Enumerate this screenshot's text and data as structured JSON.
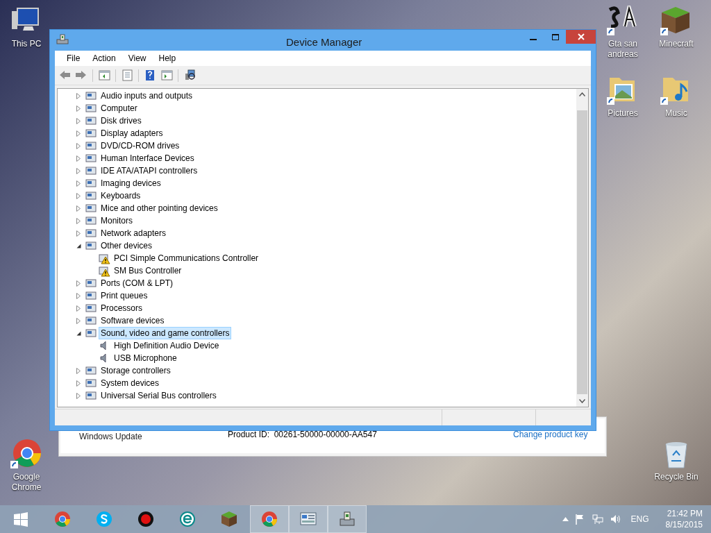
{
  "desktop_icons": [
    {
      "label": "This PC",
      "kind": "pc"
    },
    {
      "label": "Gta san andreas",
      "kind": "sa"
    },
    {
      "label": "Minecraft",
      "kind": "minecraft"
    },
    {
      "label": "Pictures",
      "kind": "pictures"
    },
    {
      "label": "Music",
      "kind": "music"
    },
    {
      "label": "Google Chrome",
      "kind": "chrome"
    },
    {
      "label": "Recycle Bin",
      "kind": "bin"
    }
  ],
  "background_window": {
    "partial_label": "Windows Update",
    "product_id_label": "Product ID:",
    "product_id": "00261-50000-00000-AA547",
    "link": "Change product key"
  },
  "window": {
    "title": "Device Manager",
    "menu": [
      "File",
      "Action",
      "View",
      "Help"
    ],
    "toolbar_groups": [
      {
        "buttons": [
          {
            "kind": "back"
          },
          {
            "kind": "forward"
          }
        ]
      },
      {
        "buttons": [
          {
            "kind": "console"
          }
        ]
      },
      {
        "buttons": [
          {
            "kind": "properties"
          }
        ]
      },
      {
        "buttons": [
          {
            "kind": "help"
          },
          {
            "kind": "action"
          }
        ]
      },
      {
        "buttons": [
          {
            "kind": "scan"
          }
        ]
      }
    ],
    "tree": [
      {
        "label": "Audio inputs and outputs",
        "expanded": false,
        "selected": false
      },
      {
        "label": "Computer",
        "expanded": false,
        "selected": false
      },
      {
        "label": "Disk drives",
        "expanded": false,
        "selected": false
      },
      {
        "label": "Display adapters",
        "expanded": false,
        "selected": false
      },
      {
        "label": "DVD/CD-ROM drives",
        "expanded": false,
        "selected": false
      },
      {
        "label": "Human Interface Devices",
        "expanded": false,
        "selected": false
      },
      {
        "label": "IDE ATA/ATAPI controllers",
        "expanded": false,
        "selected": false
      },
      {
        "label": "Imaging devices",
        "expanded": false,
        "selected": false
      },
      {
        "label": "Keyboards",
        "expanded": false,
        "selected": false
      },
      {
        "label": "Mice and other pointing devices",
        "expanded": false,
        "selected": false
      },
      {
        "label": "Monitors",
        "expanded": false,
        "selected": false
      },
      {
        "label": "Network adapters",
        "expanded": false,
        "selected": false
      },
      {
        "label": "Other devices",
        "expanded": true,
        "selected": false,
        "children": [
          {
            "label": "PCI Simple Communications Controller",
            "selected": false,
            "warning": true
          },
          {
            "label": "SM Bus Controller",
            "selected": false,
            "warning": true
          }
        ]
      },
      {
        "label": "Ports (COM & LPT)",
        "expanded": false,
        "selected": false
      },
      {
        "label": "Print queues",
        "expanded": false,
        "selected": false
      },
      {
        "label": "Processors",
        "expanded": false,
        "selected": false
      },
      {
        "label": "Software devices",
        "expanded": false,
        "selected": false
      },
      {
        "label": "Sound, video and game controllers",
        "expanded": true,
        "selected": true,
        "children": [
          {
            "label": "High Definition Audio Device",
            "selected": false,
            "warning": false
          },
          {
            "label": "USB Microphone",
            "selected": false,
            "warning": false
          }
        ]
      },
      {
        "label": "Storage controllers",
        "expanded": false,
        "selected": false
      },
      {
        "label": "System devices",
        "expanded": false,
        "selected": false
      },
      {
        "label": "Universal Serial Bus controllers",
        "expanded": false,
        "selected": false
      }
    ]
  },
  "taskbar": {
    "apps": [
      {
        "kind": "start",
        "selected": false
      },
      {
        "kind": "chrome",
        "selected": false
      },
      {
        "kind": "skype",
        "selected": false
      },
      {
        "kind": "record",
        "selected": false
      },
      {
        "kind": "eset",
        "selected": false
      },
      {
        "kind": "minecraft",
        "selected": false
      },
      {
        "kind": "chrome",
        "selected": true
      },
      {
        "kind": "control",
        "selected": true
      },
      {
        "kind": "devmgr",
        "selected": true
      }
    ],
    "language": "ENG",
    "time": "21:42 PM",
    "date": "8/15/2015"
  }
}
